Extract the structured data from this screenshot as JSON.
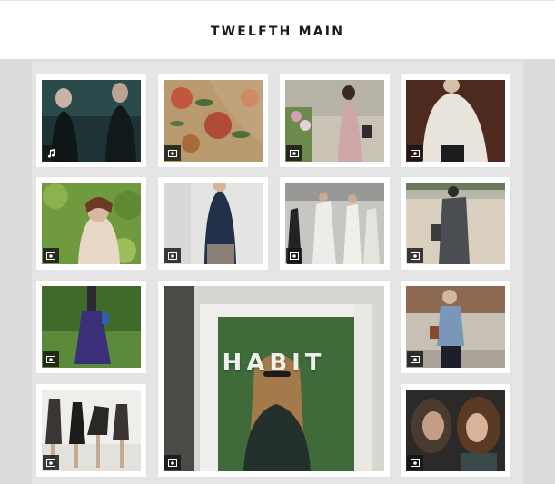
{
  "header": {
    "title": "TWELFTH MAIN"
  },
  "colors": {
    "page_bg": "#dcdcdc",
    "tile_bg": "#ffffff",
    "badge_bg": "#141414"
  },
  "tiles": [
    {
      "name": "tile-men-dark-portrait",
      "icon": "music-note-icon"
    },
    {
      "name": "tile-floral-fabric",
      "icon": "photo-icon"
    },
    {
      "name": "tile-woman-flowers-bag",
      "icon": "photo-icon"
    },
    {
      "name": "tile-white-drape-top",
      "icon": "photo-icon"
    },
    {
      "name": "tile-woman-leaf-crown",
      "icon": "photo-icon"
    },
    {
      "name": "tile-navy-cardigan",
      "icon": "photo-icon"
    },
    {
      "name": "tile-group-white-dresses",
      "icon": "photo-icon"
    },
    {
      "name": "tile-grey-scarf-street",
      "icon": "photo-icon"
    },
    {
      "name": "tile-purple-skirt",
      "icon": "photo-icon"
    },
    {
      "name": "tile-habit-storefront",
      "icon": "photo-icon",
      "sign": "HABIT"
    },
    {
      "name": "tile-denim-shirt-street",
      "icon": "photo-icon"
    },
    {
      "name": "tile-group-lean-forward",
      "icon": "photo-icon"
    },
    {
      "name": "tile-women-close-faces",
      "icon": "photo-icon"
    }
  ]
}
